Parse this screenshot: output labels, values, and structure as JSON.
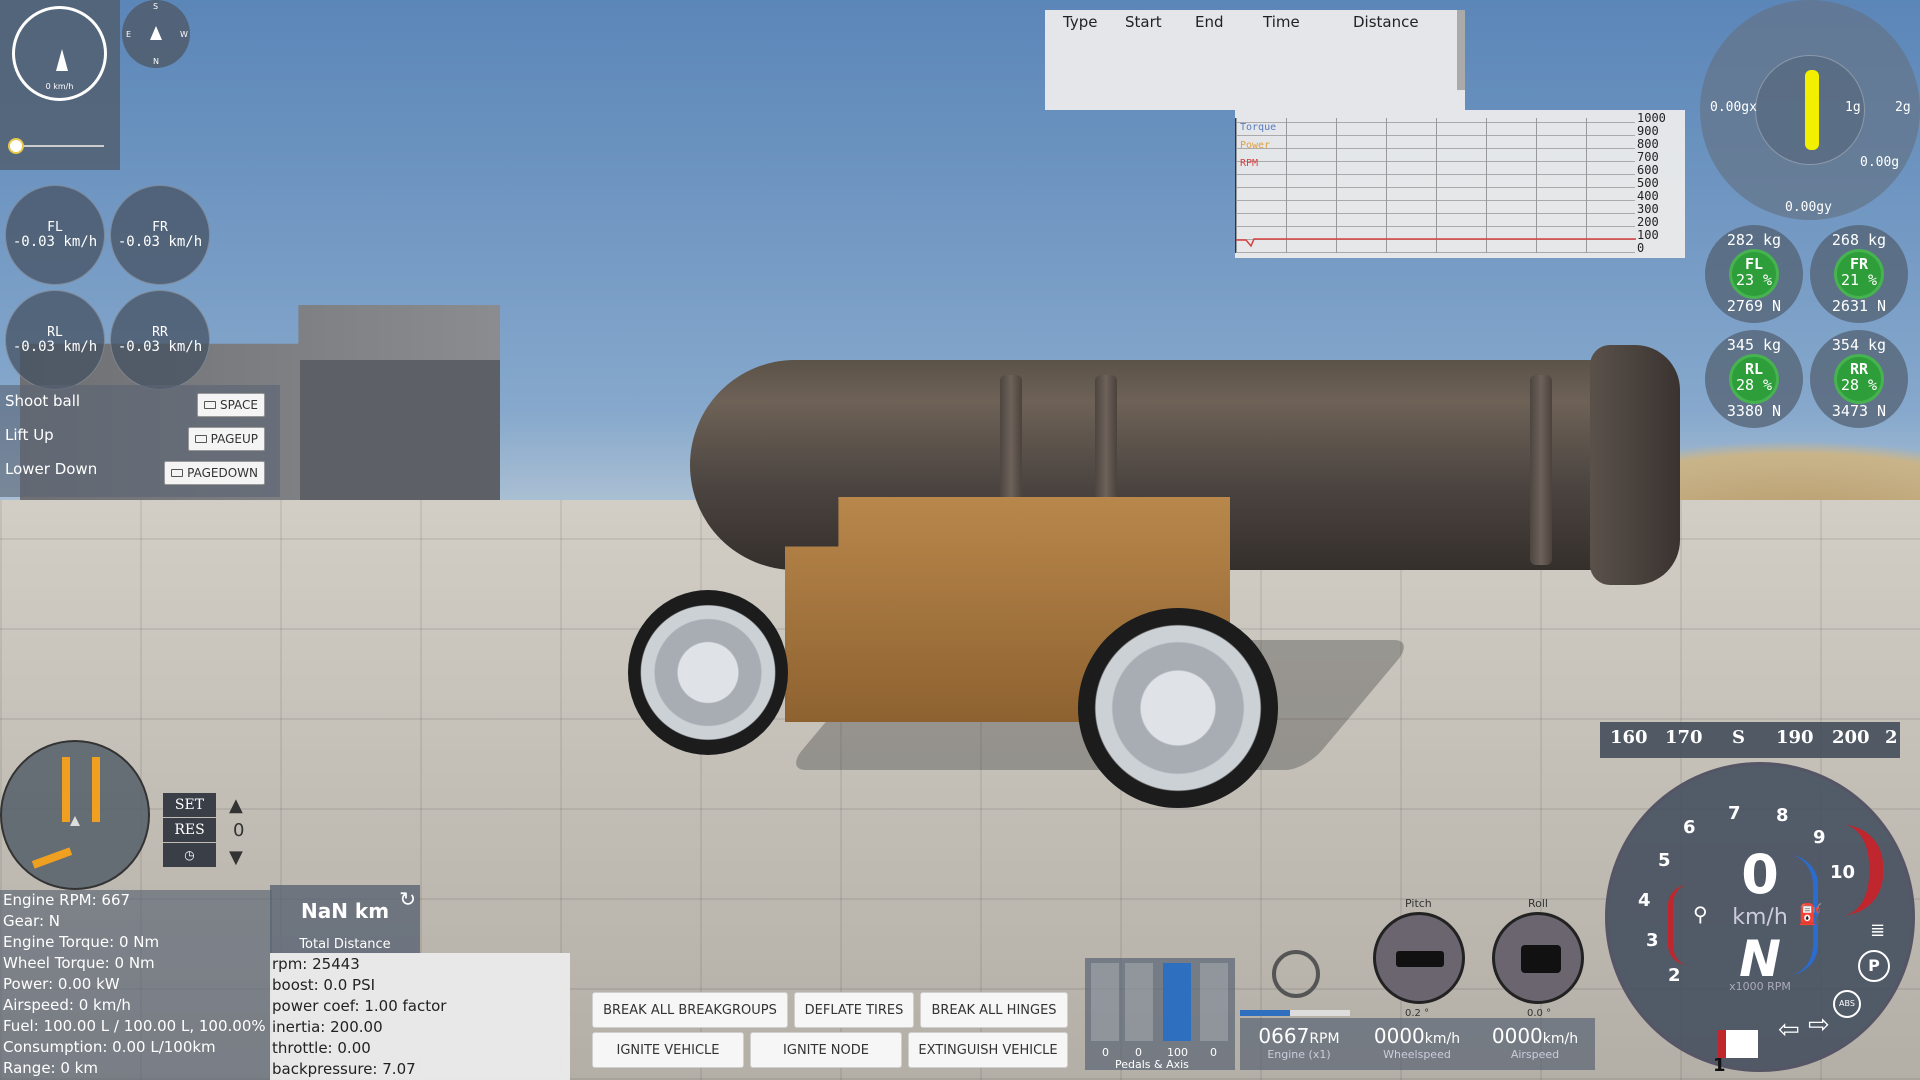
{
  "hud": {
    "speedometer_value": "0 km/h",
    "compass_letters": [
      "S",
      "E",
      "W",
      "N"
    ],
    "wheel_speeds": [
      {
        "label": "FL",
        "value": "-0.03 km/h"
      },
      {
        "label": "FR",
        "value": "-0.03 km/h"
      },
      {
        "label": "RL",
        "value": "-0.03 km/h"
      },
      {
        "label": "RR",
        "value": "-0.03 km/h"
      }
    ],
    "actions": [
      {
        "label": "Shoot ball",
        "key": "SPACE"
      },
      {
        "label": "Lift Up",
        "key": "PAGEUP"
      },
      {
        "label": "Lower Down",
        "key": "PAGEDOWN"
      }
    ],
    "timing_headers": [
      "Type",
      "Start",
      "End",
      "Time",
      "Distance"
    ],
    "graph": {
      "legend": [
        "Torque",
        "Power",
        "RPM"
      ],
      "yticks": [
        "1000",
        "900",
        "800",
        "700",
        "600",
        "500",
        "400",
        "300",
        "200",
        "100",
        "0"
      ]
    },
    "gforce": {
      "x_value": "0.00gx",
      "y_value": "0.00gy",
      "g_value": "0.00g",
      "ring1": "1g",
      "ring2": "2g"
    },
    "tires": [
      {
        "mass": "282 kg",
        "name": "FL",
        "pct": "23 %",
        "force": "2769 N"
      },
      {
        "mass": "268 kg",
        "name": "FR",
        "pct": "21 %",
        "force": "2631 N"
      },
      {
        "mass": "345 kg",
        "name": "RL",
        "pct": "28 %",
        "force": "3380 N"
      },
      {
        "mass": "354 kg",
        "name": "RR",
        "pct": "28 %",
        "force": "3473 N"
      }
    ],
    "cruise": {
      "set": "SET",
      "res": "RES",
      "value": "0"
    },
    "stats": [
      "Engine RPM: 667",
      "Gear: N",
      "Engine Torque: 0 Nm",
      "Wheel Torque: 0 Nm",
      "Power: 0.00 kW",
      "Airspeed: 0 km/h",
      "Fuel: 100.00 L / 100.00 L, 100.00%",
      "Consumption: 0.00 L/100km",
      "Range: 0 km"
    ],
    "total_distance": {
      "value": "NaN km",
      "label": "Total Distance"
    },
    "debug": [
      "rpm: 25443",
      "boost: 0.0 PSI",
      "power coef: 1.00 factor",
      "inertia: 200.00",
      "throttle: 0.00",
      "backpressure: 7.07"
    ],
    "buttons_row1": [
      "BREAK ALL BREAKGROUPS",
      "DEFLATE TIRES",
      "BREAK ALL HINGES"
    ],
    "buttons_row2": [
      "IGNITE VEHICLE",
      "IGNITE NODE",
      "EXTINGUISH VEHICLE"
    ],
    "pedals": {
      "values": [
        "0",
        "0",
        "100",
        "0"
      ],
      "fill": [
        0,
        0,
        1,
        0
      ],
      "label": "Pedals & Axis"
    },
    "readouts": [
      {
        "value": "0667",
        "unit": "RPM",
        "label": "Engine (x1)"
      },
      {
        "value": "0000",
        "unit": "km/h",
        "label": "Wheelspeed"
      },
      {
        "value": "0000",
        "unit": "km/h",
        "label": "Airspeed"
      }
    ],
    "attitude": {
      "pitch_label": "Pitch",
      "pitch_value": "0.2 °",
      "roll_label": "Roll",
      "roll_value": "0.0 °"
    },
    "heading_tape": [
      "160",
      "170",
      "S",
      "190",
      "200",
      "2"
    ],
    "tach": {
      "speed": "0",
      "unit": "km/h",
      "gear": "N",
      "rpm_label": "x1000 RPM",
      "numbers": [
        "1",
        "2",
        "3",
        "4",
        "5",
        "6",
        "7",
        "8",
        "9",
        "10"
      ],
      "abs": "ABS",
      "park": "P"
    },
    "colors": {
      "accent_green": "#2e9e3a",
      "redline": "#c0262d",
      "blue_arc": "#2b6cd0",
      "pedal_fill": "#2f6fbf"
    }
  }
}
